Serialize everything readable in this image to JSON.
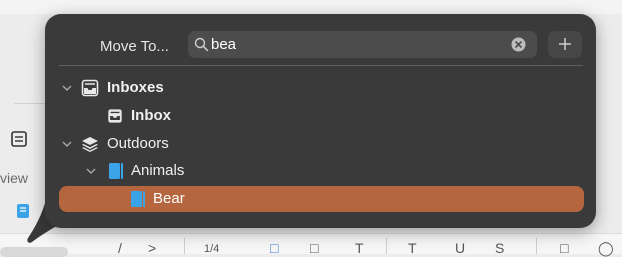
{
  "popover": {
    "title": "Move To...",
    "search": {
      "value": "bea",
      "placeholder": ""
    },
    "clear_icon": "clear-circle-icon",
    "add_icon": "plus-icon"
  },
  "tree": [
    {
      "label": "Inboxes",
      "icon": "inbox-tray-icon",
      "bold": true,
      "expanded": true,
      "level": 0
    },
    {
      "label": "Inbox",
      "icon": "inbox-tray-icon",
      "bold": true,
      "level": 1
    },
    {
      "label": "Outdoors",
      "icon": "layers-stack-icon",
      "bold": false,
      "expanded": true,
      "level": 0
    },
    {
      "label": "Animals",
      "icon": "notebook-icon",
      "bold": false,
      "expanded": true,
      "level": 1
    },
    {
      "label": "Bear",
      "icon": "notebook-icon",
      "bold": false,
      "level": 2,
      "selected": true
    }
  ],
  "background": {
    "partial_label": "view",
    "tools": [
      "/",
      ">",
      "1/4",
      "□",
      "T",
      "U",
      "S",
      "□",
      "◯"
    ]
  },
  "colors": {
    "popover_bg": "#3a3a3a",
    "selection": "#b5663f",
    "notebook_blue": "#3ba3e8",
    "search_bg": "#4c4c4c"
  }
}
